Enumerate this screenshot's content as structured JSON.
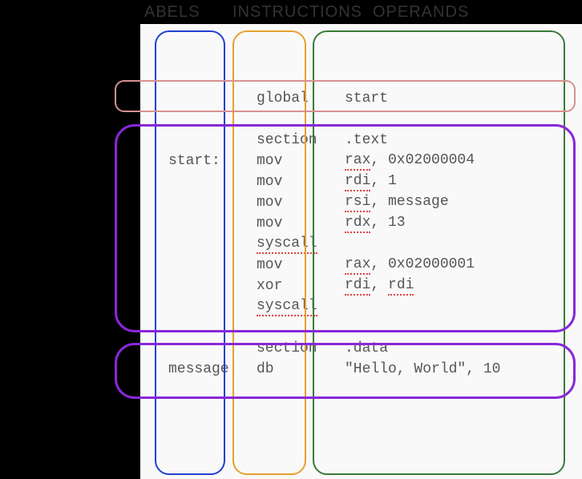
{
  "headers": {
    "labels": "ABELS",
    "instructions": "INSTRUCTIONS",
    "operands": "OPERANDS"
  },
  "rows": [
    {
      "label": "",
      "instr": "global",
      "oper": "start",
      "parts": []
    },
    {
      "spacer": true
    },
    {
      "label": "",
      "instr": "section",
      "oper": ".text",
      "parts": []
    },
    {
      "label": "start:",
      "instr": "mov",
      "oper": "rax, 0x02000004",
      "parts": [
        {
          "t": "rax",
          "u": true
        },
        {
          "t": ", 0x02000004"
        }
      ]
    },
    {
      "label": "",
      "instr": "mov",
      "oper": "rdi, 1",
      "parts": [
        {
          "t": "rdi",
          "u": true
        },
        {
          "t": ", 1"
        }
      ]
    },
    {
      "label": "",
      "instr": "mov",
      "oper": "rsi, message",
      "parts": [
        {
          "t": "rsi",
          "u": true
        },
        {
          "t": ", message"
        }
      ]
    },
    {
      "label": "",
      "instr": "mov",
      "oper": "rdx, 13",
      "parts": [
        {
          "t": "rdx",
          "u": true
        },
        {
          "t": ", 13"
        }
      ]
    },
    {
      "label": "",
      "instr": "syscall",
      "oper": "",
      "instr_u": true,
      "parts": []
    },
    {
      "label": "",
      "instr": "mov",
      "oper": "rax, 0x02000001",
      "parts": [
        {
          "t": "rax",
          "u": true
        },
        {
          "t": ", 0x02000001"
        }
      ]
    },
    {
      "label": "",
      "instr": "xor",
      "oper": "rdi, rdi",
      "parts": [
        {
          "t": "rdi",
          "u": true
        },
        {
          "t": ", "
        },
        {
          "t": "rdi",
          "u": true
        }
      ]
    },
    {
      "label": "",
      "instr": "syscall",
      "oper": "",
      "instr_u": true,
      "parts": []
    },
    {
      "spacer": true
    },
    {
      "label": "",
      "instr": "section",
      "oper": ".data",
      "parts": []
    },
    {
      "label": "message:",
      "instr": "db",
      "oper": "\"Hello, World\", 10",
      "parts": []
    }
  ]
}
